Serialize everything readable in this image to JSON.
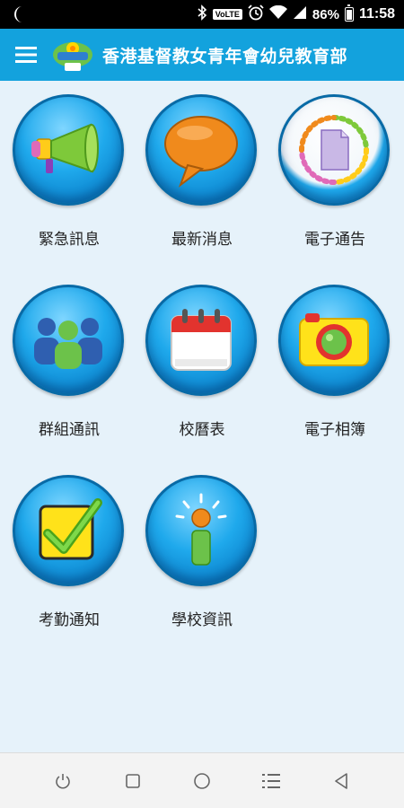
{
  "status_bar": {
    "volte_label": "VoLTE",
    "battery": "86%",
    "time": "11:58"
  },
  "app_bar": {
    "title": "香港基督教女青年會幼兒教育部",
    "menu_icon": "hamburger-menu-icon",
    "logo": "ywca-logo"
  },
  "tiles": [
    {
      "label": "緊急訊息",
      "icon": "megaphone-icon"
    },
    {
      "label": "最新消息",
      "icon": "speech-bubble-icon"
    },
    {
      "label": "電子通告",
      "icon": "document-cycle-icon"
    },
    {
      "label": "群組通訊",
      "icon": "group-people-icon"
    },
    {
      "label": "校曆表",
      "icon": "calendar-icon"
    },
    {
      "label": "電子相簿",
      "icon": "camera-icon"
    },
    {
      "label": "考勤通知",
      "icon": "checkbox-icon"
    },
    {
      "label": "學校資訊",
      "icon": "info-icon"
    }
  ],
  "nav_bar": {
    "buttons": [
      "power-icon",
      "square-icon",
      "circle-home-icon",
      "list-menu-icon",
      "back-triangle-icon"
    ]
  },
  "colors": {
    "app_bar": "#13a2dd",
    "background": "#e6f2fa",
    "circle_blue": "#1fa9ec"
  }
}
